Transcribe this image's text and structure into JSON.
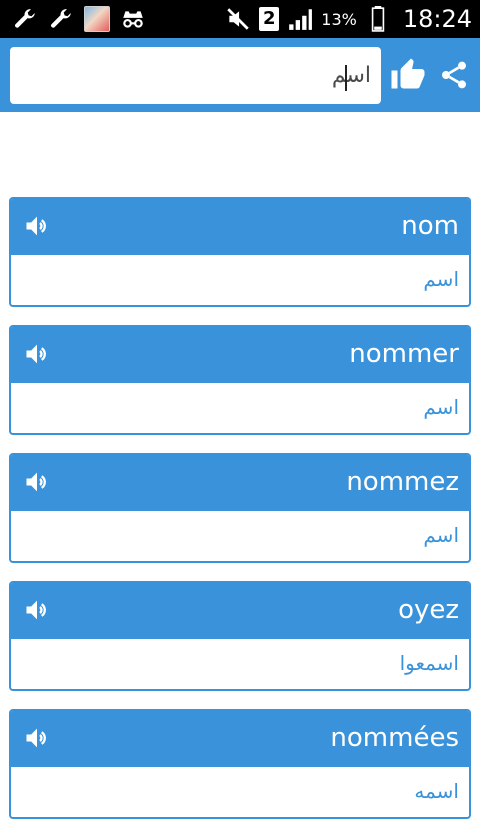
{
  "status_bar": {
    "icons_left": [
      "wrench-icon",
      "wrench-icon",
      "photo-thumbnail",
      "incognito-icon"
    ],
    "sim_slot": "2",
    "battery_percent": "13%",
    "time": "18:24"
  },
  "header": {
    "search_value": "اسم",
    "accent": "#3a93da"
  },
  "results": [
    {
      "term": "nom",
      "translation": "اسم"
    },
    {
      "term": "nommer",
      "translation": "اسم"
    },
    {
      "term": "nommez",
      "translation": "اسم"
    },
    {
      "term": "oyez",
      "translation": "اسمعوا"
    },
    {
      "term": "nommées",
      "translation": "اسمه"
    }
  ]
}
